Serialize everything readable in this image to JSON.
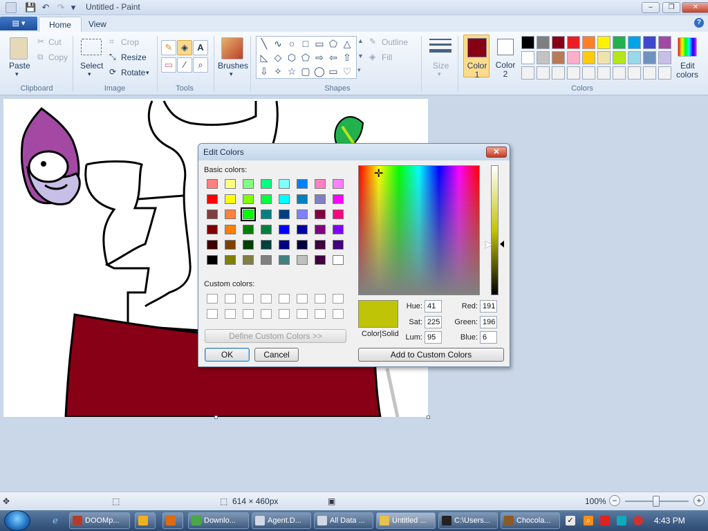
{
  "window": {
    "title": "Untitled - Paint",
    "minimize": "–",
    "restore": "❐",
    "close": "✕"
  },
  "quick_access": {
    "save_icon": "💾",
    "undo_icon": "↶",
    "redo_icon": "↷",
    "menu_icon": "▾"
  },
  "ribbon_tabs": {
    "app_menu": "▤ ▾",
    "home": "Home",
    "view": "View",
    "help": "?"
  },
  "clipboard": {
    "paste": "Paste",
    "cut": "Cut",
    "copy": "Copy",
    "label": "Clipboard"
  },
  "image": {
    "select": "Select",
    "crop": "Crop",
    "resize": "Resize",
    "rotate": "Rotate",
    "label": "Image"
  },
  "tools": {
    "pencil": "✎",
    "fill": "◈",
    "text": "A",
    "eraser": "▭",
    "picker": "⁄",
    "magnifier": "⌕",
    "label": "Tools"
  },
  "brushes": {
    "label": "Brushes"
  },
  "shapes": {
    "glyphs": [
      "╲",
      "∿",
      "○",
      "□",
      "▭",
      "⬠",
      "△",
      "◺",
      "◇",
      "⬡",
      "⬠",
      "⇨",
      "⇦",
      "⇧",
      "⇩",
      "✧",
      "☆",
      "▢",
      "◯",
      "▭",
      "♡"
    ],
    "outline": "Outline",
    "fill": "Fill",
    "size": "Size",
    "label": "Shapes"
  },
  "colors": {
    "color1_label_line1": "Color",
    "color1_label_line2": "1",
    "color2_label_line1": "Color",
    "color2_label_line2": "2",
    "color1_value": "#880015",
    "color2_value": "#ffffff",
    "edit_line1": "Edit",
    "edit_line2": "colors",
    "label": "Colors",
    "palette_row1": [
      "#000000",
      "#7f7f7f",
      "#880015",
      "#ed1c24",
      "#ff7f27",
      "#fff200",
      "#22b14c",
      "#00a2e8",
      "#3f48cc",
      "#a349a4"
    ],
    "palette_row2": [
      "#ffffff",
      "#c3c3c3",
      "#b97a57",
      "#ffaec9",
      "#ffc90e",
      "#efe4b0",
      "#b5e61d",
      "#99d9ea",
      "#7092be",
      "#c8bfe7"
    ],
    "palette_row3": [
      "#f2f2f2",
      "#f2f2f2",
      "#f2f2f2",
      "#f2f2f2",
      "#f2f2f2",
      "#f2f2f2",
      "#f2f2f2",
      "#f2f2f2",
      "#f2f2f2",
      "#f2f2f2"
    ]
  },
  "dialog": {
    "title": "Edit Colors",
    "close_icon": "✕",
    "basic_colors_label": "Basic colors:",
    "custom_colors_label": "Custom colors:",
    "basic_colors": [
      [
        "#ff8080",
        "#ffff80",
        "#80ff80",
        "#00ff80",
        "#80ffff",
        "#0080ff",
        "#ff80c0",
        "#ff80ff"
      ],
      [
        "#ff0000",
        "#ffff00",
        "#80ff00",
        "#00ff40",
        "#00ffff",
        "#0080c0",
        "#8080c0",
        "#ff00ff"
      ],
      [
        "#804040",
        "#ff8040",
        "#00ff00",
        "#008080",
        "#004080",
        "#8080ff",
        "#800040",
        "#ff0080"
      ],
      [
        "#800000",
        "#ff8000",
        "#008000",
        "#008040",
        "#0000ff",
        "#0000a0",
        "#800080",
        "#8000ff"
      ],
      [
        "#400000",
        "#804000",
        "#004000",
        "#004040",
        "#000080",
        "#000040",
        "#400040",
        "#400080"
      ],
      [
        "#000000",
        "#808000",
        "#808040",
        "#808080",
        "#408080",
        "#c0c0c0",
        "#400040",
        "#ffffff"
      ]
    ],
    "selected_basic": "#00ff00",
    "define_custom": "Define Custom Colors >>",
    "ok": "OK",
    "cancel": "Cancel",
    "color_solid": "Color|Solid",
    "preview_color": "#bfc406",
    "hue_label": "Hue:",
    "hue": "41",
    "sat_label": "Sat:",
    "sat": "225",
    "lum_label": "Lum:",
    "lum": "95",
    "red_label": "Red:",
    "red": "191",
    "green_label": "Green:",
    "green": "196",
    "blue_label": "Blue:",
    "blue": "6",
    "add_custom": "Add to Custom Colors"
  },
  "status": {
    "canvas_size": "614 × 460px",
    "zoom": "100%",
    "zoom_out": "−",
    "zoom_in": "+",
    "move_icon": "✥",
    "select_icon": "⬚",
    "size_icon": "⬚",
    "disk_icon": "▣"
  },
  "taskbar": {
    "items": [
      {
        "label": "DOOMp...",
        "color": "#b33b2b"
      },
      {
        "label": "",
        "color": "#f0b020"
      },
      {
        "label": "",
        "color": "#e06a10"
      },
      {
        "label": "Downlo...",
        "color": "#4aa84a"
      },
      {
        "label": "Agent.D...",
        "color": "#d0d8e4"
      },
      {
        "label": "All Data ...",
        "color": "#d0d8e4"
      },
      {
        "label": "Untitled ...",
        "color": "#e8c050"
      },
      {
        "label": "C:\\Users...",
        "color": "#222222"
      },
      {
        "label": "Chocola...",
        "color": "#8a5a2a"
      }
    ],
    "clock": "4:43 PM"
  }
}
